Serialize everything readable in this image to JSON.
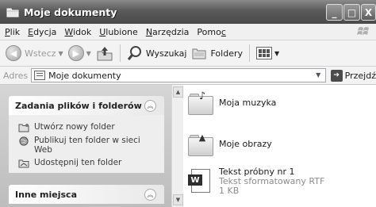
{
  "window": {
    "title": "Moje dokumenty",
    "minimize_label": "_",
    "maximize_label": "□",
    "close_label": "X"
  },
  "menu": {
    "items": [
      {
        "first": "P",
        "rest": "lik"
      },
      {
        "first": "E",
        "rest": "dycja"
      },
      {
        "first": "W",
        "rest": "idok"
      },
      {
        "first": "U",
        "rest": "lubione"
      },
      {
        "first": "N",
        "rest": "arzędzia"
      },
      {
        "first": "Pomo",
        "rest": "c",
        "underline_last": true
      }
    ]
  },
  "toolbar": {
    "back_label": "Wstecz",
    "search_label": "Wyszukaj",
    "folders_label": "Foldery"
  },
  "address": {
    "label": "Adres",
    "value": "Moje dokumenty",
    "go_label": "Przejdź"
  },
  "taskpane": {
    "file_tasks": {
      "title": "Zadania plików i folderów",
      "items": [
        {
          "label": "Utwórz nowy folder",
          "icon": "new-folder-icon"
        },
        {
          "label": "Publikuj ten folder w sieci Web",
          "icon": "publish-web-icon"
        },
        {
          "label": "Udostępnij ten folder",
          "icon": "share-folder-icon"
        }
      ]
    },
    "other_places": {
      "title": "Inne miejsca"
    }
  },
  "content": {
    "items": [
      {
        "name": "Moja muzyka",
        "icon": "music-folder-icon"
      },
      {
        "name": "Moje obrazy",
        "icon": "pictures-folder-icon"
      },
      {
        "name": "Tekst próbny nr 1",
        "type": "Tekst sformatowany RTF",
        "size": "1 KB",
        "icon": "rtf-document-icon"
      }
    ]
  }
}
